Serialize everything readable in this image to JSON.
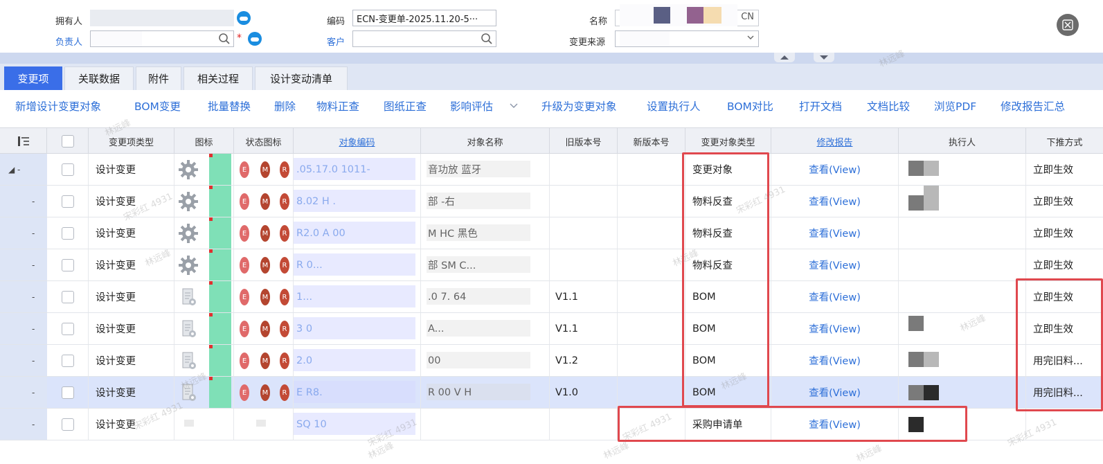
{
  "header": {
    "owner_label": "拥有人",
    "manager_label": "负责人",
    "code_label": "编码",
    "code_value": "ECN-变更单-2025.11.20-5···",
    "customer_label": "客户",
    "name_label": "名称",
    "name_suffix": "CN",
    "source_label": "变更来源",
    "required_mark": "*"
  },
  "tabs": [
    "变更项",
    "关联数据",
    "附件",
    "相关过程",
    "设计变动清单"
  ],
  "toolbar": [
    "新增设计变更对象",
    "BOM变更",
    "批量替换",
    "删除",
    "物料正查",
    "图纸正查",
    "影响评估",
    "升级为变更对象",
    "设置执行人",
    "BOM对比",
    "打开文档",
    "文档比较",
    "浏览PDF",
    "修改报告汇总"
  ],
  "columns": {
    "type": "变更项类型",
    "icon": "图标",
    "status_icon": "状态图标",
    "code": "对象编码",
    "name": "对象名称",
    "old_ver": "旧版本号",
    "new_ver": "新版本号",
    "obj_type": "变更对象类型",
    "report": "修改报告",
    "executor": "执行人",
    "push": "下推方式"
  },
  "rows": [
    {
      "tree": "◢ -",
      "type": "设计变更",
      "code": ".05.17.0   1011-",
      "name": "       音功放    蓝牙",
      "old": "",
      "obj_type": "变更对象",
      "report": "查看(View)",
      "push": "立即生效"
    },
    {
      "tree": "-",
      "type": "设计变更",
      "code": "8.02          H   .",
      "name": "  部     -右",
      "old": "",
      "obj_type": "物料反查",
      "report": "查看(View)",
      "push": "立即生效"
    },
    {
      "tree": "-",
      "type": "设计变更",
      "code": "R2.0          A   00",
      "name": "   M    HC       黑色",
      "old": "",
      "obj_type": "物料反查",
      "report": "查看(View)",
      "push": "立即生效"
    },
    {
      "tree": "-",
      "type": "设计变更",
      "code": "R                 0...",
      "name": "   部        SM   C...",
      "old": "",
      "obj_type": "物料反查",
      "report": "查看(View)",
      "push": "立即生效"
    },
    {
      "tree": "-",
      "type": "设计变更",
      "code": "              1...",
      "name": " .0      7.      64",
      "old": "V1.1",
      "obj_type": "BOM",
      "report": "查看(View)",
      "push": "立即生效"
    },
    {
      "tree": "-",
      "type": "设计变更",
      "code": "    3   0",
      "name": "                 A...",
      "old": "V1.1",
      "obj_type": "BOM",
      "report": "查看(View)",
      "push": "立即生效"
    },
    {
      "tree": "-",
      "type": "设计变更",
      "code": "     2.0",
      "name": "                00",
      "old": "V1.2",
      "obj_type": "BOM",
      "report": "查看(View)",
      "push": "用完旧料..."
    },
    {
      "tree": "-",
      "type": "设计变更",
      "code": "E     R8.",
      "name": "R     00    V  H",
      "old": "V1.0",
      "obj_type": "BOM",
      "report": "查看(View)",
      "push": "用完旧料..."
    },
    {
      "tree": "-",
      "type": "设计变更",
      "code": "  SQ     10",
      "name": "",
      "old": "",
      "obj_type": "采购申请单",
      "report": "查看(View)",
      "push": ""
    }
  ],
  "watermark": "林远峰",
  "watermark2": "宋彩红 4931",
  "colors": {
    "accent": "#3a6ee8",
    "link": "#2d6fd8",
    "highlight_box": "#e0484e",
    "selected_row": "#dbe4fb"
  }
}
